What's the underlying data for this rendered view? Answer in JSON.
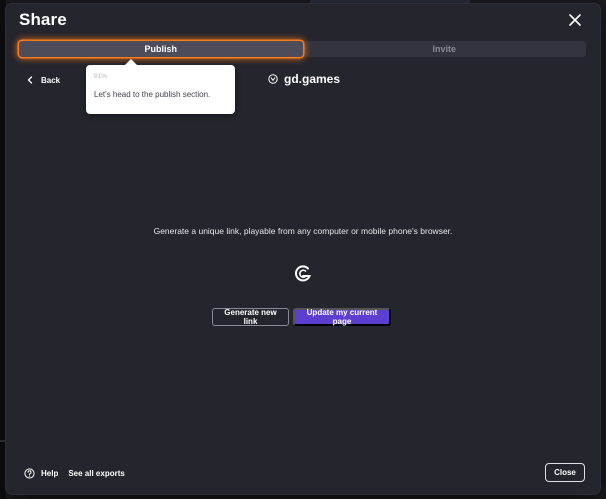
{
  "dialog": {
    "title": "Share"
  },
  "tabs": [
    {
      "label": "Publish",
      "active": true
    },
    {
      "label": "Invite",
      "active": false
    }
  ],
  "nav": {
    "back_label": "Back",
    "back_icon": "chevron-left-icon"
  },
  "tooltip": {
    "progress": "91%",
    "message": "Let's head to the publish section."
  },
  "brand": {
    "name": "gd.games",
    "icon": "gdgames-logo-icon"
  },
  "main": {
    "description": "Generate a unique link, playable from any computer or mobile phone's browser.",
    "logo_icon": "gdevelop-logo-icon"
  },
  "buttons": {
    "generate_label": "Generate new link",
    "update_label": "Update my current page"
  },
  "footer": {
    "help_label": "Help",
    "exports_label": "See all exports",
    "close_label": "Close"
  },
  "colors": {
    "highlight": "#ff7a1a",
    "primary": "#5b3fd1",
    "dialog_bg": "#25252d"
  }
}
